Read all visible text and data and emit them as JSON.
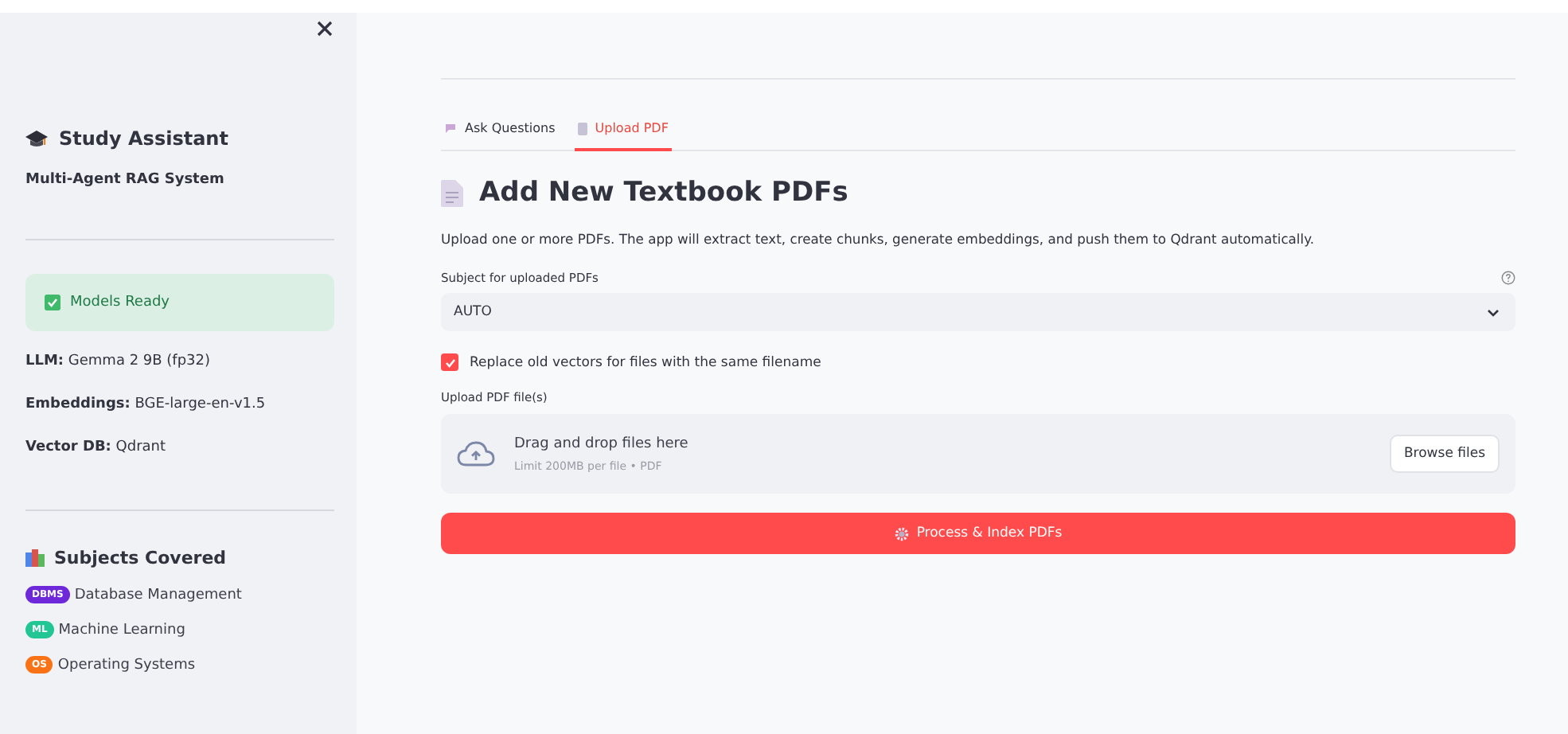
{
  "sidebar": {
    "title": "Study Assistant",
    "subtitle": "Multi-Agent RAG System",
    "status": "Models Ready",
    "info": [
      "**LLM:** Gemma 2 9B (fp32)",
      "**Embeddings:** BGE-large-en-v1.5",
      "**Vector DB:** Qdrant"
    ],
    "subjects_title": "Subjects Covered",
    "subjects": [
      {
        "badge": "DBMS",
        "label": "Database Management",
        "color": "#6d28d9"
      },
      {
        "badge": "ML",
        "label": "Machine Learning",
        "color": "#22c594"
      },
      {
        "badge": "OS",
        "label": "Operating Systems",
        "color": "#f97316"
      }
    ]
  },
  "tabs": [
    {
      "label": "Ask Questions",
      "selected": false
    },
    {
      "label": "Upload PDF",
      "selected": true
    }
  ],
  "heading": "Add New Textbook PDFs",
  "description": "Upload one or more PDFs. The app will extract text, create chunks, generate embeddings, and push them to Qdrant automatically.",
  "subject_select": {
    "label": "Subject for uploaded PDFs",
    "value": "AUTO"
  },
  "replace_checkbox": {
    "label": "Replace old vectors for files with the same filename",
    "checked": true
  },
  "uploader": {
    "label": "Upload PDF file(s)",
    "title": "Drag and drop files here",
    "hint": "Limit 200MB per file • PDF",
    "button": "Browse files"
  },
  "process_button": "Process & Index PDFs"
}
